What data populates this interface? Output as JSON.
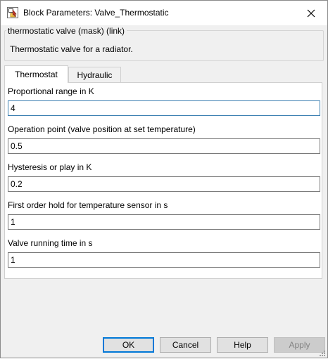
{
  "window": {
    "title": "Block Parameters: Valve_Thermostatic",
    "close_icon": "close-icon"
  },
  "mask": {
    "title": "thermostatic valve (mask) (link)",
    "description": "Thermostatic valve for a radiator."
  },
  "tabs": [
    {
      "label": "Thermostat",
      "active": true
    },
    {
      "label": "Hydraulic",
      "active": false
    }
  ],
  "params": [
    {
      "label": "Proportional range in K",
      "value": "4"
    },
    {
      "label": "Operation point (valve position at set temperature)",
      "value": "0.5"
    },
    {
      "label": "Hysteresis or play in K",
      "value": "0.2"
    },
    {
      "label": "First order hold for temperature sensor in s",
      "value": "1"
    },
    {
      "label": "Valve running time in s",
      "value": "1"
    }
  ],
  "buttons": {
    "ok": "OK",
    "cancel": "Cancel",
    "help": "Help",
    "apply": "Apply"
  },
  "colors": {
    "focus_border": "#3c7fb1",
    "default_button_border": "#0078d7",
    "disabled_text": "#838383"
  }
}
